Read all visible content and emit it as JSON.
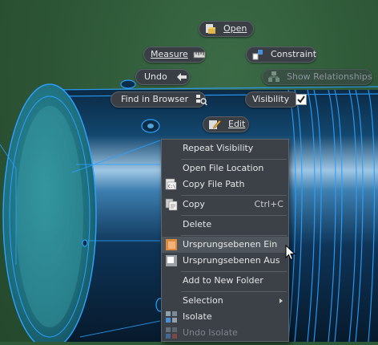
{
  "marking_menu": {
    "open": "Open",
    "measure": "Measure",
    "constraint": "Constraint",
    "undo": "Undo",
    "show_relationships": "Show Relationships",
    "find_in_browser": "Find in Browser",
    "visibility": "Visibility",
    "edit": "Edit"
  },
  "context_menu": {
    "items": [
      {
        "label": "Repeat Visibility"
      },
      {
        "label": "Open File Location"
      },
      {
        "label": "Copy File Path"
      },
      {
        "label": "Copy",
        "shortcut": "Ctrl+C"
      },
      {
        "label": "Delete"
      },
      {
        "label": "Ursprungsebenen Ein"
      },
      {
        "label": "Ursprungsebenen Aus"
      },
      {
        "label": "Add to New Folder"
      },
      {
        "label": "Selection"
      },
      {
        "label": "Isolate"
      },
      {
        "label": "Undo Isolate"
      }
    ]
  },
  "colors": {
    "background": "#2c5535",
    "model_edge": "#2aa0ff",
    "menu_bg": "#3c4148",
    "pill_bg": "#3a3f46"
  }
}
